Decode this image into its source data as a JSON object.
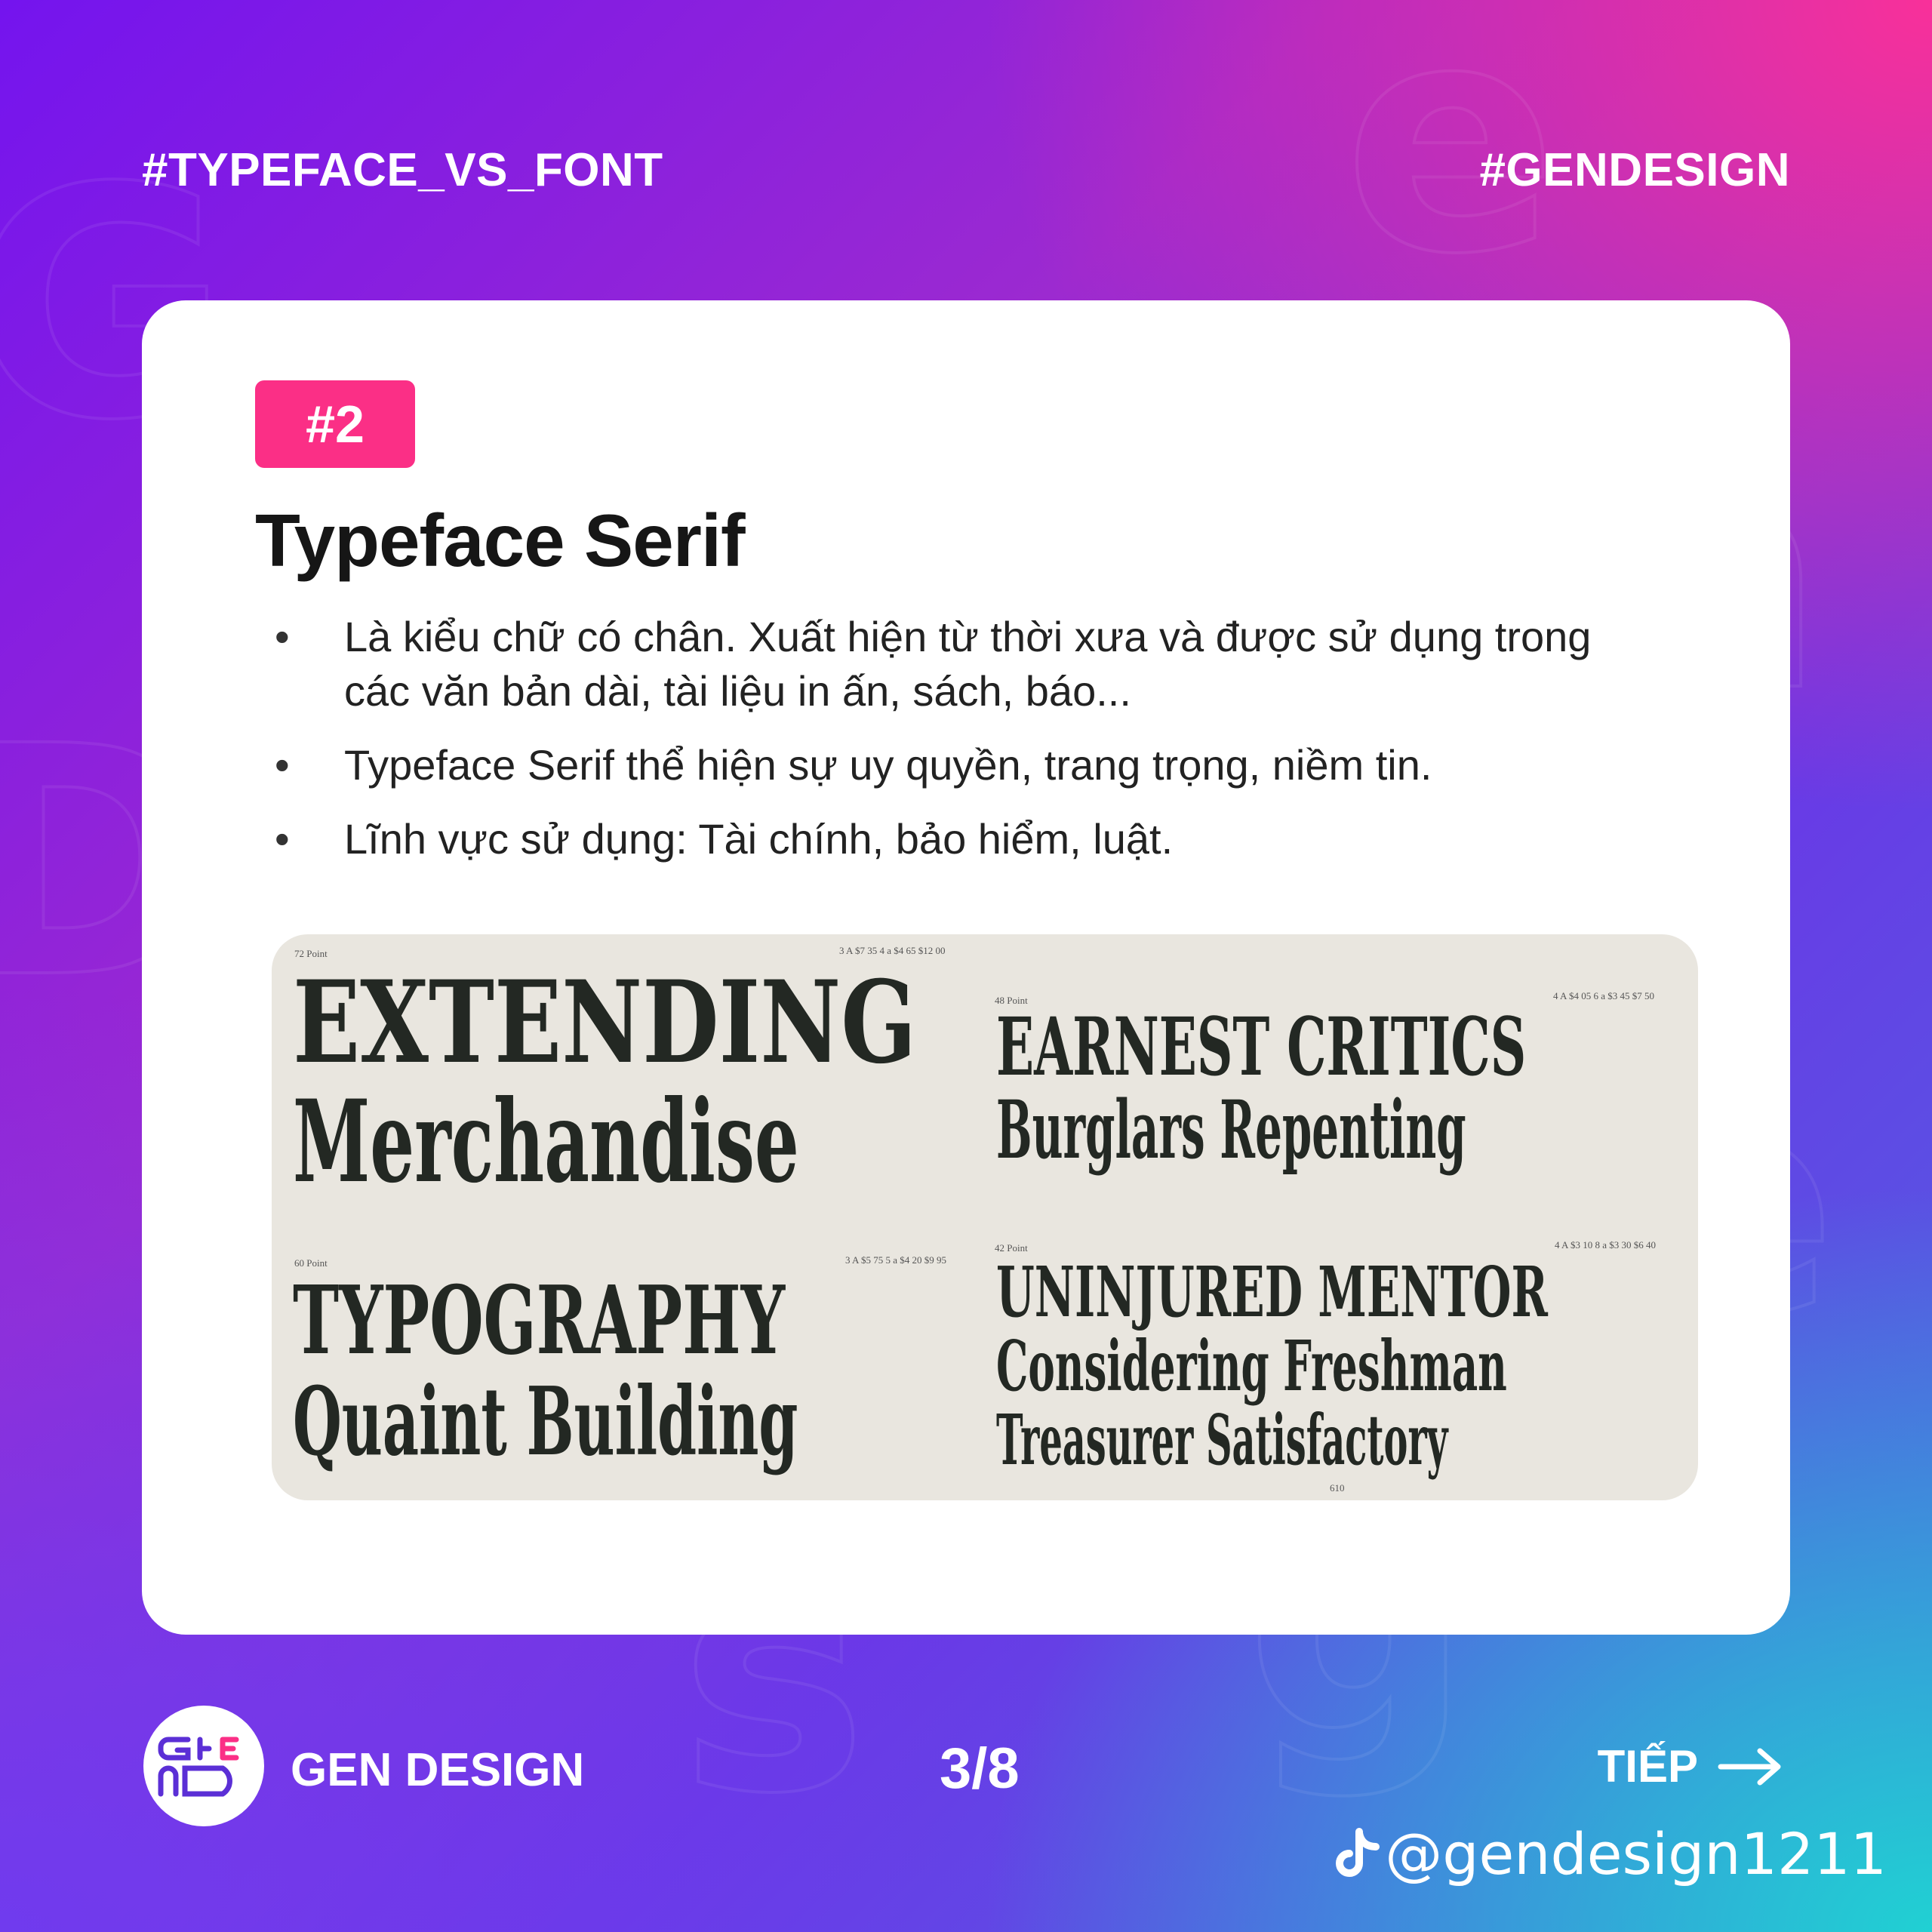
{
  "header": {
    "left_tag": "#TYPEFACE_VS_FONT",
    "right_tag": "#GENDESIGN"
  },
  "card": {
    "badge": "#2",
    "title": "Typeface Serif",
    "bullets": [
      "Là kiểu chữ có chân. Xuất hiện từ thời xưa và được sử dụng trong các văn bản dài, tài liệu in ấn, sách, báo...",
      "Typeface Serif thể hiện sự uy quyền, trang trọng, niềm tin.",
      "Lĩnh vực sử dụng: Tài chính, bảo hiểm, luật."
    ]
  },
  "specimen": {
    "blocks": [
      {
        "size_label": "72 Point",
        "price": "3 A $7 35   4 a $4 65   $12 00",
        "lines": [
          "EXTENDING",
          "Merchandise"
        ]
      },
      {
        "size_label": "48 Point",
        "price": "4 A $4 05   6 a $3 45   $7 50",
        "lines": [
          "EARNEST CRITICS",
          "Burglars Repenting"
        ]
      },
      {
        "size_label": "60 Point",
        "price": "3 A $5 75   5 a $4 20   $9 95",
        "lines": [
          "TYPOGRAPHY",
          "Quaint Building"
        ]
      },
      {
        "size_label": "42 Point",
        "price": "4 A $3 10   8 a $3 30   $6 40",
        "lines": [
          "UNINJURED MENTOR",
          "Considering Freshman",
          "Treasurer Satisfactory"
        ]
      }
    ],
    "page_number": "610"
  },
  "footer": {
    "brand": "GEN DESIGN",
    "logo_text": "GEND",
    "pager": "3/8",
    "next_label": "TIẾP",
    "handle": "@gendesign1211",
    "icons": [
      "arrow-right-icon",
      "tiktok-icon"
    ]
  },
  "colors": {
    "accent_pink": "#fb2f86",
    "card_bg": "#ffffff",
    "specimen_bg": "#e9e6df",
    "ink": "#232823"
  }
}
